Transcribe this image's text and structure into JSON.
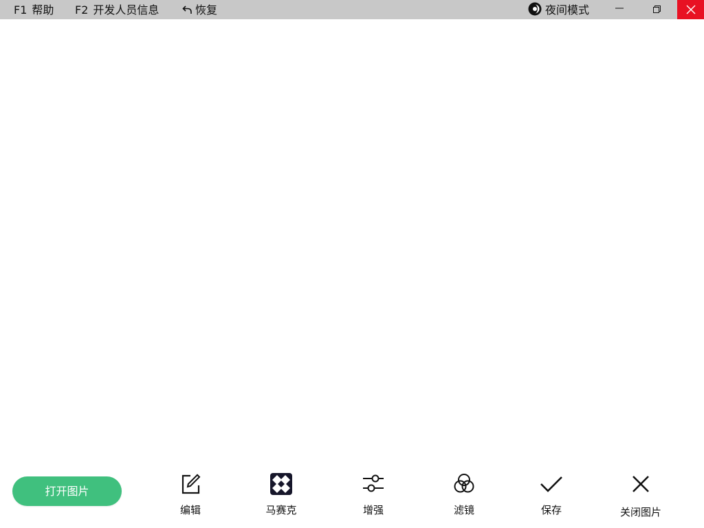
{
  "topbar": {
    "help": {
      "key": "F1",
      "label": "帮助"
    },
    "developer": {
      "key": "F2",
      "label": "开发人员信息"
    },
    "restore": {
      "label": "恢复",
      "icon": "undo-arrow-icon"
    },
    "night_mode": {
      "label": "夜间模式",
      "icon": "night-mode-icon"
    },
    "window_controls": [
      "minimize",
      "restore",
      "close"
    ],
    "close_color": "#e81123",
    "bar_color": "#c8c8c8"
  },
  "toolbar": {
    "open_image": {
      "label": "打开图片",
      "color": "#40c07e"
    },
    "tools": [
      {
        "label": "编辑",
        "icon": "edit-icon"
      },
      {
        "label": "马赛克",
        "icon": "mosaic-icon"
      },
      {
        "label": "增强",
        "icon": "sliders-icon"
      },
      {
        "label": "滤镜",
        "icon": "filter-circles-icon"
      },
      {
        "label": "保存",
        "icon": "checkmark-icon"
      },
      {
        "label": "关闭图片",
        "icon": "close-x-icon"
      }
    ]
  }
}
